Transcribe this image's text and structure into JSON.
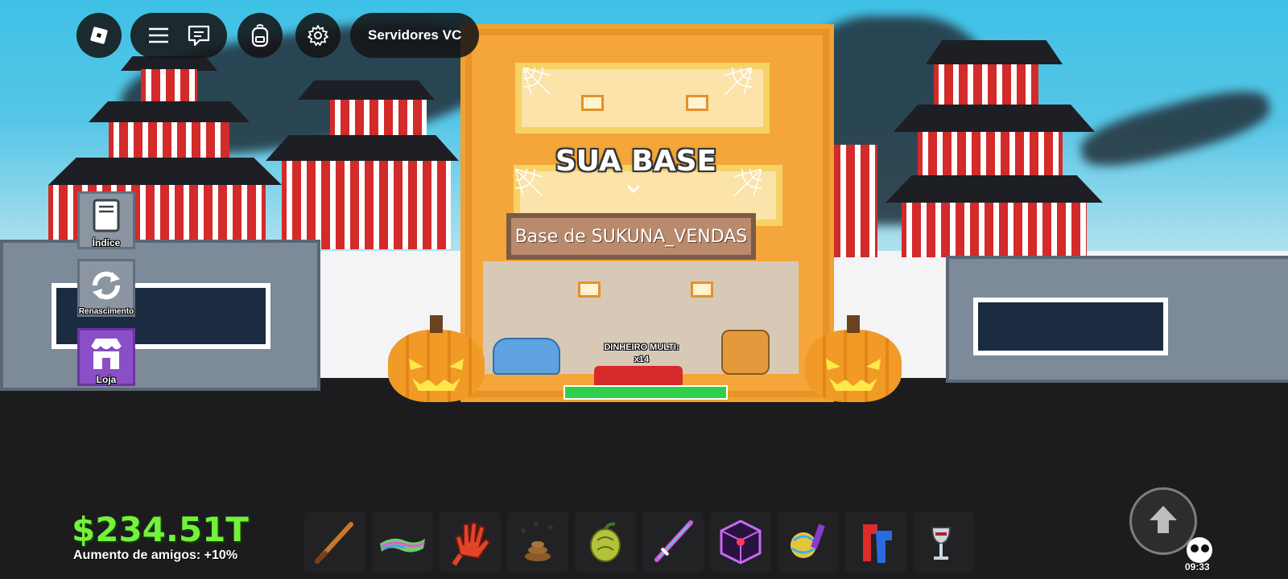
{
  "topbar": {
    "roblox_menu": "roblox-logo-icon",
    "menu_icon": "hamburger-icon",
    "chat_icon": "chat-icon",
    "backpack_icon": "backpack-icon",
    "settings_icon": "gear-icon",
    "servers_label": "Servidores VC"
  },
  "side_menu": {
    "items": [
      {
        "label": "Índice",
        "icon": "book-icon"
      },
      {
        "label": "Renascimento",
        "icon": "refresh-icon"
      },
      {
        "label": "Loja",
        "icon": "shop-icon"
      }
    ]
  },
  "world": {
    "headline": "SUA BASE",
    "base_sign": "Base de SUKUNA_VENDAS",
    "multiplier_label": "DINHEIRO MULTI:",
    "multiplier_value": "x14"
  },
  "hud": {
    "money": "$234.51T",
    "friends_bonus": "Aumento de amigos: +10%",
    "time": "09:33",
    "jump_icon": "up-arrow-icon",
    "status_icon": "character-face-icon"
  },
  "hotbar": {
    "items": [
      "baseball-bat-icon",
      "rainbow-carpet-icon",
      "lava-glove-icon",
      "poop-flies-icon",
      "devil-fruit-icon",
      "rainbow-sword-icon",
      "purple-cube-icon",
      "disco-hammer-icon",
      "red-blue-blocks-icon",
      "goblet-icon"
    ]
  },
  "colors": {
    "money_green": "#72f23a",
    "building_orange": "#f4a63a",
    "shop_purple": "#8a4fc7"
  }
}
